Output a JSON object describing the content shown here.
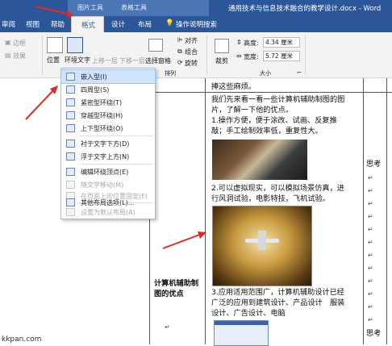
{
  "titlebar": {
    "context_picture_tools": "图片工具",
    "context_table_tools": "表格工具",
    "doc_title": "通用技术与信息技术融合的教学设计.docx - Word"
  },
  "tabs": {
    "review": "审阅",
    "view": "视图",
    "help": "帮助",
    "format": "格式",
    "design": "设计",
    "layout": "布局",
    "tell_me": "操作说明搜索"
  },
  "ribbon": {
    "border_label": "边框",
    "effects_label": "效果",
    "position_label": "位置",
    "wrap_text_label": "环境文字",
    "bring_forward_label": "上移一层",
    "send_backward_label": "下移一层",
    "selection_pane_label": "选择窗格",
    "align_label": "对齐",
    "group_label": "组合",
    "rotate_label": "旋转",
    "crop_label": "裁剪",
    "height_label": "高度:",
    "height_value": "4.34 厘米",
    "width_label": "宽度:",
    "width_value": "5.72 厘米",
    "arrange_group": "排列",
    "size_group": "大小",
    "dialog_launcher": "⌐"
  },
  "wrap_menu": {
    "items": [
      {
        "label": "嵌入型(I)",
        "enabled": true,
        "highlighted": true,
        "icon": "inline-icon"
      },
      {
        "label": "四周型(S)",
        "enabled": true,
        "icon": "square-icon"
      },
      {
        "label": "紧密型环绕(T)",
        "enabled": true,
        "icon": "tight-icon"
      },
      {
        "label": "穿越型环绕(H)",
        "enabled": true,
        "icon": "through-icon"
      },
      {
        "label": "上下型环绕(O)",
        "enabled": true,
        "icon": "top-bottom-icon"
      },
      {
        "label": "衬于文字下方(D)",
        "enabled": true,
        "icon": "behind-text-icon"
      },
      {
        "label": "浮于文字上方(N)",
        "enabled": true,
        "icon": "in-front-icon"
      },
      {
        "label": "编辑环绕顶点(E)",
        "enabled": true,
        "icon": "edit-points-icon"
      },
      {
        "label": "随文字移动(M)",
        "enabled": false,
        "icon": "move-with-text-icon"
      },
      {
        "label": "在页面上的位置固定(F)",
        "enabled": false,
        "icon": "fix-position-icon"
      },
      {
        "label": "其他布局选项(L)...",
        "enabled": true,
        "icon": "more-layout-icon"
      },
      {
        "label": "设置为默认布局(A)",
        "enabled": false,
        "icon": "default-layout-icon"
      }
    ]
  },
  "document": {
    "left_cell_title_line1": "计算机辅助制",
    "left_cell_title_line2": "图的优点",
    "para_mark": "↵",
    "lines": [
      "捧这些麻烦。",
      "我们先来看一看一些计算机辅助制图的图",
      "片，了解一下他的优点。",
      "1.操作方便，便于涂改、试画、反复推",
      "敲；手工绘制效率低，重复性大。",
      "2.可以虚拟现实，可以模拟场景仿真，进",
      "行风洞试验，电影特技，飞机试验。",
      "3.应用适用范围广，计算机辅助设计已经",
      "广泛的应用到建筑设计、产品设计　服装",
      "设计、广告设计、电脑"
    ],
    "right_col_word_1": "思考",
    "right_col_word_2": "思考"
  },
  "watermark": {
    "left_url": "kkpan.com"
  },
  "colors": {
    "word_blue": "#2b579a",
    "ribbon_bg": "#f3f3f3",
    "menu_highlight": "#cfe3fb",
    "arrow_red": "#e02a2a"
  }
}
